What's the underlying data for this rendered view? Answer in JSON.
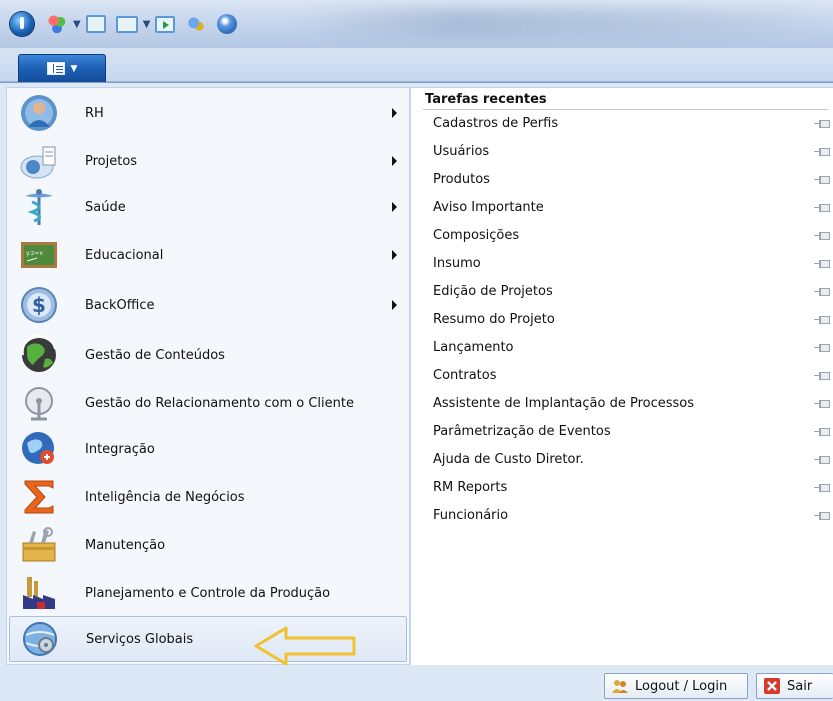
{
  "quick_access": {
    "icons": [
      "app-orb-icon",
      "palette-icon",
      "new-window-icon",
      "window-icon",
      "run-icon",
      "settings-icon",
      "globe-icon"
    ]
  },
  "app_button": {
    "icon": "application-menu-icon"
  },
  "left_menu": {
    "items": [
      {
        "label": "RH",
        "icon": "people-icon",
        "has_submenu": true
      },
      {
        "label": "Projetos",
        "icon": "projects-icon",
        "has_submenu": true
      },
      {
        "label": "Saúde",
        "icon": "caduceus-icon",
        "has_submenu": true
      },
      {
        "label": "Educacional",
        "icon": "chalkboard-icon",
        "has_submenu": true
      },
      {
        "label": "BackOffice",
        "icon": "dollar-icon",
        "has_submenu": true
      },
      {
        "label": "Gestão de Conteúdos",
        "icon": "globe-green-icon",
        "has_submenu": false
      },
      {
        "label": "Gestão do Relacionamento com o Cliente",
        "icon": "satellite-dish-icon",
        "has_submenu": false
      },
      {
        "label": "Integração",
        "icon": "integration-globe-icon",
        "has_submenu": false
      },
      {
        "label": "Inteligência de Negócios",
        "icon": "sigma-icon",
        "has_submenu": false
      },
      {
        "label": "Manutenção",
        "icon": "toolbox-icon",
        "has_submenu": false
      },
      {
        "label": "Planejamento e Controle da Produção",
        "icon": "factory-icon",
        "has_submenu": false
      },
      {
        "label": "Serviços Globais",
        "icon": "global-services-icon",
        "has_submenu": false,
        "selected": true
      }
    ]
  },
  "recent": {
    "title": "Tarefas recentes",
    "items": [
      "Cadastros de Perfis",
      "Usuários",
      "Produtos",
      "Aviso Importante",
      "Composições",
      "Insumo",
      "Edição de Projetos",
      "Resumo do Projeto",
      "Lançamento",
      "Contratos",
      "Assistente de Implantação de Processos",
      "Parâmetrização de Eventos",
      "Ajuda de Custo Diretor.",
      "RM Reports",
      "Funcionário"
    ]
  },
  "footer": {
    "logout_label": "Logout / Login",
    "exit_label": "Sair"
  },
  "colors": {
    "accent": "#1d5fb4",
    "annotation_arrow": "#f2c12e"
  }
}
